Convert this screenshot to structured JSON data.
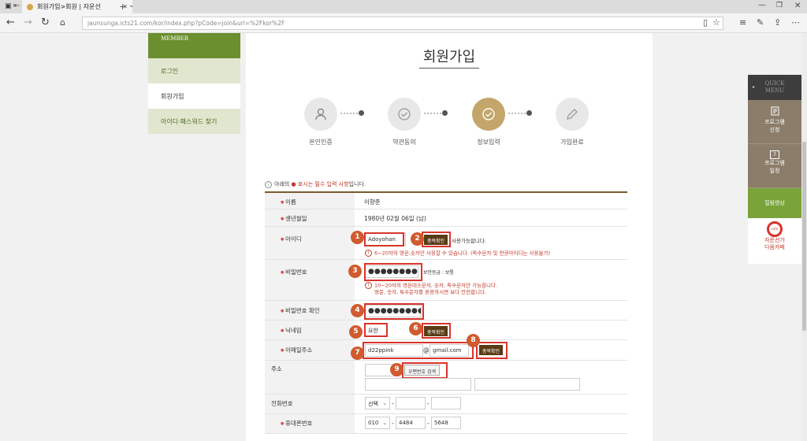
{
  "browser": {
    "tab_title": "회원가입>회원 | 자운선",
    "url_host": "jaunsunga.icts21.com",
    "url_path": "/kor/index.php?pCode=join&url=%2Fkor%2F",
    "url_prefix": "jaunsunga.icts21.com/kor/index.php?pCode=join&url=%2Fkor%2F"
  },
  "sidebar": {
    "header": "MEMBER",
    "items": [
      {
        "label": "로그인"
      },
      {
        "label": "회원가입"
      },
      {
        "label": "아이디·패스워드 찾기"
      }
    ]
  },
  "page": {
    "title": "회원가입"
  },
  "steps": [
    {
      "label": "본인인증",
      "icon": "person-icon"
    },
    {
      "label": "약관동의",
      "icon": "check-icon"
    },
    {
      "label": "정보입력",
      "icon": "check-icon"
    },
    {
      "label": "가입완료",
      "icon": "pencil-icon"
    }
  ],
  "steps_active": 2,
  "notice": {
    "pre": "아래의 ",
    "mark": "● 표시는 필수 입력 사항",
    "post": "입니다."
  },
  "form": {
    "name": {
      "label": "이름",
      "value": "이향준"
    },
    "birth": {
      "label": "생년월일",
      "value": "1980년 02월 06일 (남)"
    },
    "id": {
      "label": "아이디",
      "value": "Adoyohan",
      "button": "중복확인",
      "status": "사용가능합니다.",
      "warning": "6~20자의 영문,숫자만 사용할 수 있습니다. (특수문자 및 한글아이디는 사용불가)"
    },
    "password": {
      "label": "비밀번호",
      "value": "●●●●●●●●●",
      "strength": "보안등급 : 보통",
      "warning1": "10~20자의 영문대소문자, 숫자, 특수문자만 가능합니다.",
      "warning2": "영문, 숫자, 특수문자를 혼용하시면 보다 안전합니다."
    },
    "password_confirm": {
      "label": "비밀번호 확인",
      "value": "●●●●●●●●●"
    },
    "nickname": {
      "label": "닉네임",
      "value": "요한",
      "button": "중복확인"
    },
    "email": {
      "label": "이메일주소",
      "local": "d22ppink",
      "at": "@",
      "domain": "gmail.com",
      "button": "중복확인"
    },
    "address": {
      "label": "주소",
      "button": "우편번호 검색"
    },
    "phone": {
      "label": "전화번호",
      "select": "선택",
      "dash": "-"
    },
    "mobile": {
      "label": "휴대폰번호",
      "select": "010",
      "mid": "4484",
      "last": "5648",
      "dash": "-"
    }
  },
  "annotations": [
    "1",
    "2",
    "3",
    "4",
    "5",
    "6",
    "7",
    "8",
    "9"
  ],
  "quick_menu": {
    "header_line1": "QUICK",
    "header_line2": "MENU",
    "item1_line1": "프로그램",
    "item1_line2": "신청",
    "item2_day": "7",
    "item2_line1": "프로그램",
    "item2_line2": "일정",
    "item3": "힐링영상",
    "item4_logo": "cafe",
    "item4_line1": "자운선가",
    "item4_line2": "다음카페"
  }
}
